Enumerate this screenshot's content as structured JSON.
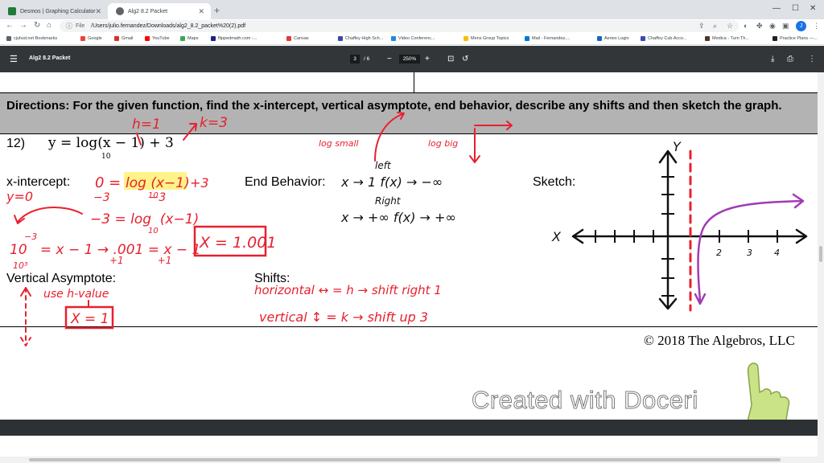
{
  "browser": {
    "tabs": [
      {
        "title": "Desmos | Graphing Calculator",
        "active": false,
        "favicon_color": "#1f7a3a"
      },
      {
        "title": "Alg2 8.2 Packet",
        "active": true,
        "favicon_color": "#5f6368"
      }
    ],
    "address": {
      "scheme_label": "File",
      "url": "/Users/julio.fernandez/Downloads/alg2_8.2_packet%20(2).pdf"
    },
    "profile_initial": "J",
    "bookmarks": [
      {
        "label": "cjuhsd.net Bookmarks",
        "color": "#5f6368"
      },
      {
        "label": "Google",
        "color": "#ea4335"
      },
      {
        "label": "Gmail",
        "color": "#d93025"
      },
      {
        "label": "YouTube",
        "color": "#ff0000"
      },
      {
        "label": "Maps",
        "color": "#34a853"
      },
      {
        "label": "flippedmath.com -...",
        "color": "#1a237e"
      },
      {
        "label": "Canvas",
        "color": "#e53935"
      },
      {
        "label": "Chaffey High Sch...",
        "color": "#3949ab"
      },
      {
        "label": "Video Conferenc...",
        "color": "#1e88e5"
      },
      {
        "label": "Mens Group Topics",
        "color": "#fbbc04"
      },
      {
        "label": "Mail - Fernandez,...",
        "color": "#0078d4"
      },
      {
        "label": "Aeries Login",
        "color": "#1565c0"
      },
      {
        "label": "Chaffey Cub Acco...",
        "color": "#3949ab"
      },
      {
        "label": "Medica - Turn Th...",
        "color": "#4e342e"
      },
      {
        "label": "Practice Plans —...",
        "color": "#212121"
      }
    ]
  },
  "pdf_viewer": {
    "title": "Alg2 8.2 Packet",
    "current_page": "3",
    "total_pages": "/ 6",
    "zoom": "250%"
  },
  "document": {
    "directions": "Directions: For the given function, find the x-intercept, vertical asymptote, end behavior, describe any shifts and then sketch the graph.",
    "problem_number": "12)",
    "equation": "y = log(x − 1) + 3",
    "equation_base": "10",
    "labels": {
      "x_intercept": "x-intercept:",
      "end_behavior": "End Behavior:",
      "sketch": "Sketch:",
      "vertical_asymptote": "Vertical Asymptote:",
      "shifts": "Shifts:"
    },
    "copyright": "© 2018 The Algebros, LLC"
  },
  "handwriting": {
    "h_eq": "h=1",
    "k_eq": "k=3",
    "log_small": "log small",
    "log_big": "log big",
    "left": "left",
    "right": "Right",
    "end_left": "x → 1   f(x) → −∞",
    "end_right": "x → +∞ f(x) → +∞",
    "y_zero": "y=0",
    "step1_a": "0 =",
    "step1_b": "log (x−1)",
    "step1_c": "+3",
    "step1_sub": "−3           −3",
    "step1_base": "10",
    "step2": "−3 = log  (x−1)",
    "step2_base": "10",
    "step3": "10   = x − 1 → .001 = x − 1",
    "step3_exp": "−3",
    "step3_plus": "+1           +1",
    "step3_den": "10³",
    "answer_x": "X = 1.001",
    "use_h": "use h-value",
    "answer_va": "X = 1",
    "shift_h": "horizontal ↔ = h → shift right 1",
    "shift_v": "vertical ↕ = k → shift up 3",
    "axis_x": "X",
    "axis_y": "Y",
    "tick_labels": [
      "2",
      "3",
      "4"
    ]
  },
  "overlay": {
    "watermark": "Created with Doceri"
  },
  "colors": {
    "ink_red": "#e8202e",
    "ink_black": "#111111",
    "ink_purple": "#a23bb4",
    "highlight": "#fff176",
    "pdf_toolbar": "#323639",
    "directions_band": "#b3b3b3"
  }
}
